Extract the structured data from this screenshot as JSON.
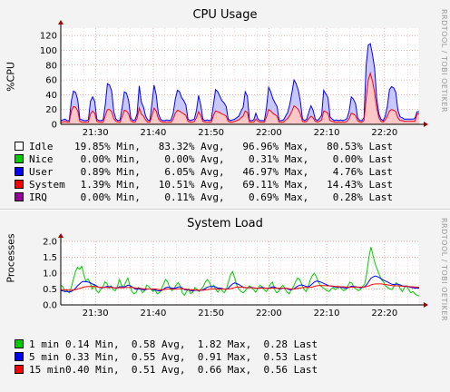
{
  "chart_data": [
    {
      "type": "area",
      "title": "CPU Usage",
      "ylabel": "%CPU",
      "side_label": "RRDTOOL / TOBI OETIKER",
      "ylim": [
        0,
        130
      ],
      "yticks": [
        "0",
        "20",
        "40",
        "60",
        "80",
        "100",
        "120"
      ],
      "xticks": [
        "21:30",
        "21:40",
        "21:50",
        "22:00",
        "22:10",
        "22:20"
      ],
      "xlim": [
        "21:24",
        "22:26"
      ],
      "grid": true,
      "series": [
        {
          "name": "Idle",
          "color": "#ffffff",
          "stats": "19.85% Min,   83.32% Avg,   96.96% Max,   80.53% Last"
        },
        {
          "name": "Nice",
          "color": "#00cc00",
          "stats": " 0.00% Min,    0.00% Avg,    0.31% Max,    0.00% Last"
        },
        {
          "name": "User",
          "color": "#0000ff",
          "stats": " 0.89% Min,    6.05% Avg,   46.97% Max,    4.76% Last",
          "values": [
            2,
            3,
            3,
            2,
            2,
            14,
            21,
            20,
            15,
            3,
            3,
            2,
            2,
            3,
            17,
            19,
            16,
            3,
            2,
            2,
            3,
            15,
            35,
            33,
            28,
            9,
            3,
            2,
            3,
            13,
            25,
            24,
            18,
            4,
            2,
            3,
            6,
            30,
            16,
            12,
            5,
            3,
            2,
            16,
            31,
            22,
            7,
            3,
            2,
            2,
            3,
            2,
            3,
            8,
            19,
            27,
            26,
            20,
            18,
            14,
            3,
            2,
            3,
            3,
            10,
            22,
            14,
            3,
            2,
            3,
            2,
            3,
            15,
            29,
            27,
            22,
            18,
            16,
            13,
            3,
            2,
            3,
            3,
            4,
            5,
            9,
            12,
            26,
            22,
            2,
            2,
            3,
            8,
            3,
            2,
            2,
            2,
            12,
            30,
            26,
            20,
            16,
            13,
            2,
            2,
            3,
            5,
            8,
            15,
            25,
            35,
            32,
            26,
            17,
            3,
            2,
            3,
            9,
            14,
            10,
            3,
            2,
            4,
            6,
            28,
            24,
            21,
            5,
            3,
            2,
            3,
            2,
            3,
            2,
            3,
            4,
            10,
            22,
            20,
            16,
            4,
            2,
            2,
            4,
            45,
            47,
            40,
            36,
            33,
            12,
            5,
            3,
            2,
            5,
            13,
            29,
            31,
            30,
            26,
            10,
            5,
            4,
            3,
            3,
            3,
            3,
            3,
            4,
            3,
            3
          ]
        },
        {
          "name": "System",
          "color": "#ff0000",
          "stats": " 1.39% Min,   10.51% Avg,   69.11% Max,   14.43% Last",
          "values": [
            3,
            3,
            4,
            3,
            3,
            18,
            24,
            23,
            18,
            4,
            3,
            3,
            3,
            3,
            14,
            18,
            15,
            4,
            3,
            3,
            3,
            12,
            20,
            20,
            17,
            8,
            4,
            3,
            3,
            11,
            19,
            18,
            14,
            5,
            3,
            3,
            8,
            22,
            14,
            11,
            6,
            3,
            3,
            12,
            22,
            18,
            8,
            4,
            3,
            3,
            3,
            3,
            3,
            7,
            15,
            19,
            18,
            16,
            14,
            12,
            4,
            3,
            3,
            4,
            9,
            17,
            12,
            4,
            3,
            3,
            3,
            3,
            12,
            18,
            17,
            16,
            14,
            13,
            11,
            4,
            3,
            3,
            4,
            5,
            6,
            9,
            11,
            18,
            16,
            3,
            3,
            3,
            7,
            4,
            3,
            3,
            3,
            10,
            20,
            18,
            15,
            13,
            11,
            3,
            3,
            3,
            6,
            8,
            12,
            18,
            25,
            23,
            20,
            14,
            4,
            3,
            4,
            8,
            11,
            9,
            4,
            3,
            4,
            6,
            18,
            17,
            15,
            5,
            4,
            3,
            3,
            3,
            3,
            3,
            3,
            4,
            8,
            15,
            14,
            12,
            5,
            3,
            3,
            5,
            35,
            60,
            69,
            58,
            43,
            22,
            9,
            4,
            3,
            6,
            11,
            18,
            20,
            19,
            17,
            9,
            5,
            5,
            4,
            4,
            4,
            4,
            4,
            4,
            14,
            14
          ]
        },
        {
          "name": "IRQ",
          "color": "#990099",
          "stats": " 0.00% Min,    0.11% Avg,    0.69% Max,    0.28% Last"
        }
      ]
    },
    {
      "type": "line",
      "title": "System Load",
      "ylabel": "Processes",
      "side_label": "RRDTOOL / TOBI OETIKER",
      "ylim": [
        0,
        2.0
      ],
      "yticks": [
        "0.0",
        "0.5",
        "1.0",
        "1.5",
        "2.0"
      ],
      "xticks": [
        "21:30",
        "21:40",
        "21:50",
        "22:00",
        "22:10",
        "22:20"
      ],
      "xlim": [
        "21:24",
        "22:26"
      ],
      "grid": true,
      "series": [
        {
          "name": "1 min",
          "color": "#00cc00",
          "stats": "0.14 Min,  0.58 Avg,  1.82 Max,  0.28 Last",
          "values": [
            0.62,
            0.58,
            0.42,
            0.45,
            0.38,
            0.55,
            0.8,
            1.05,
            1.18,
            1.12,
            1.22,
            0.95,
            0.75,
            0.82,
            0.7,
            0.5,
            0.62,
            0.45,
            0.38,
            0.48,
            0.55,
            0.72,
            0.68,
            0.52,
            0.6,
            0.48,
            0.45,
            0.58,
            0.8,
            0.62,
            0.55,
            0.72,
            0.85,
            0.6,
            0.42,
            0.35,
            0.4,
            0.55,
            0.5,
            0.38,
            0.45,
            0.62,
            0.58,
            0.5,
            0.42,
            0.48,
            0.35,
            0.38,
            0.5,
            0.65,
            0.8,
            0.72,
            0.55,
            0.45,
            0.5,
            0.62,
            0.7,
            0.6,
            0.38,
            0.3,
            0.42,
            0.5,
            0.35,
            0.4,
            0.55,
            0.48,
            0.42,
            0.5,
            0.58,
            0.72,
            0.8,
            0.7,
            0.55,
            0.62,
            0.48,
            0.4,
            0.52,
            0.45,
            0.38,
            0.5,
            0.72,
            0.95,
            1.05,
            0.85,
            0.62,
            0.5,
            0.42,
            0.38,
            0.45,
            0.52,
            0.6,
            0.55,
            0.48,
            0.4,
            0.5,
            0.62,
            0.58,
            0.48,
            0.42,
            0.5,
            0.65,
            0.72,
            0.5,
            0.38,
            0.42,
            0.55,
            0.62,
            0.5,
            0.4,
            0.35,
            0.48,
            0.58,
            0.72,
            0.85,
            0.8,
            0.65,
            0.5,
            0.42,
            0.55,
            0.78,
            0.92,
            1.0,
            0.88,
            0.72,
            0.6,
            0.55,
            0.5,
            0.45,
            0.42,
            0.5,
            0.55,
            0.48,
            0.52,
            0.58,
            0.5,
            0.45,
            0.48,
            0.6,
            0.72,
            0.68,
            0.55,
            0.5,
            0.45,
            0.48,
            0.58,
            0.65,
            1.0,
            1.5,
            1.82,
            1.55,
            1.3,
            1.12,
            0.95,
            0.8,
            0.72,
            0.6,
            0.55,
            0.5,
            0.48,
            0.58,
            0.7,
            0.65,
            0.5,
            0.42,
            0.55,
            0.6,
            0.48,
            0.38,
            0.42,
            0.35,
            0.3,
            0.28
          ]
        },
        {
          "name": "5 min",
          "color": "#0000ff",
          "stats": "0.33 Min,  0.55 Avg,  0.91 Max,  0.53 Last",
          "values": [
            0.45,
            0.44,
            0.42,
            0.42,
            0.41,
            0.42,
            0.46,
            0.52,
            0.6,
            0.66,
            0.72,
            0.74,
            0.73,
            0.72,
            0.7,
            0.66,
            0.64,
            0.6,
            0.56,
            0.54,
            0.54,
            0.56,
            0.58,
            0.57,
            0.57,
            0.55,
            0.53,
            0.53,
            0.57,
            0.57,
            0.56,
            0.58,
            0.62,
            0.61,
            0.57,
            0.52,
            0.49,
            0.5,
            0.5,
            0.48,
            0.47,
            0.49,
            0.5,
            0.5,
            0.48,
            0.48,
            0.45,
            0.44,
            0.45,
            0.49,
            0.54,
            0.56,
            0.55,
            0.53,
            0.52,
            0.54,
            0.56,
            0.57,
            0.53,
            0.48,
            0.47,
            0.47,
            0.45,
            0.44,
            0.46,
            0.46,
            0.45,
            0.46,
            0.48,
            0.52,
            0.56,
            0.58,
            0.57,
            0.58,
            0.56,
            0.53,
            0.53,
            0.52,
            0.49,
            0.49,
            0.53,
            0.6,
            0.66,
            0.69,
            0.67,
            0.64,
            0.6,
            0.56,
            0.54,
            0.54,
            0.55,
            0.55,
            0.54,
            0.52,
            0.52,
            0.54,
            0.55,
            0.54,
            0.52,
            0.52,
            0.54,
            0.57,
            0.56,
            0.53,
            0.51,
            0.51,
            0.53,
            0.53,
            0.51,
            0.48,
            0.48,
            0.5,
            0.54,
            0.59,
            0.62,
            0.63,
            0.61,
            0.58,
            0.57,
            0.6,
            0.66,
            0.72,
            0.75,
            0.74,
            0.72,
            0.69,
            0.66,
            0.63,
            0.6,
            0.59,
            0.58,
            0.56,
            0.56,
            0.56,
            0.55,
            0.54,
            0.53,
            0.54,
            0.57,
            0.59,
            0.58,
            0.57,
            0.55,
            0.54,
            0.55,
            0.57,
            0.64,
            0.74,
            0.84,
            0.88,
            0.91,
            0.89,
            0.86,
            0.82,
            0.78,
            0.75,
            0.72,
            0.68,
            0.65,
            0.64,
            0.65,
            0.65,
            0.63,
            0.6,
            0.59,
            0.59,
            0.57,
            0.55,
            0.54,
            0.53,
            0.53,
            0.53
          ]
        },
        {
          "name": "15 min",
          "color": "#ff0000",
          "stats": "0.40 Min,  0.51 Avg,  0.66 Max,  0.56 Last",
          "values": [
            0.48,
            0.48,
            0.47,
            0.47,
            0.46,
            0.46,
            0.47,
            0.48,
            0.5,
            0.52,
            0.54,
            0.56,
            0.57,
            0.58,
            0.58,
            0.58,
            0.58,
            0.57,
            0.56,
            0.55,
            0.55,
            0.55,
            0.55,
            0.55,
            0.55,
            0.54,
            0.54,
            0.54,
            0.54,
            0.54,
            0.54,
            0.55,
            0.55,
            0.55,
            0.55,
            0.54,
            0.53,
            0.52,
            0.52,
            0.51,
            0.51,
            0.51,
            0.5,
            0.5,
            0.5,
            0.5,
            0.49,
            0.48,
            0.48,
            0.48,
            0.49,
            0.5,
            0.5,
            0.5,
            0.5,
            0.5,
            0.51,
            0.51,
            0.51,
            0.5,
            0.49,
            0.48,
            0.48,
            0.47,
            0.47,
            0.47,
            0.46,
            0.46,
            0.46,
            0.47,
            0.48,
            0.49,
            0.5,
            0.5,
            0.5,
            0.5,
            0.5,
            0.5,
            0.5,
            0.49,
            0.5,
            0.51,
            0.53,
            0.55,
            0.56,
            0.56,
            0.56,
            0.55,
            0.55,
            0.54,
            0.54,
            0.54,
            0.54,
            0.53,
            0.53,
            0.53,
            0.53,
            0.53,
            0.53,
            0.52,
            0.52,
            0.53,
            0.53,
            0.53,
            0.52,
            0.52,
            0.52,
            0.52,
            0.52,
            0.51,
            0.5,
            0.5,
            0.51,
            0.52,
            0.53,
            0.54,
            0.55,
            0.55,
            0.55,
            0.55,
            0.56,
            0.58,
            0.6,
            0.61,
            0.61,
            0.61,
            0.61,
            0.6,
            0.6,
            0.59,
            0.59,
            0.58,
            0.58,
            0.57,
            0.57,
            0.57,
            0.56,
            0.56,
            0.56,
            0.56,
            0.56,
            0.56,
            0.56,
            0.56,
            0.56,
            0.56,
            0.58,
            0.6,
            0.63,
            0.65,
            0.66,
            0.66,
            0.66,
            0.66,
            0.65,
            0.64,
            0.63,
            0.62,
            0.61,
            0.6,
            0.6,
            0.6,
            0.59,
            0.59,
            0.58,
            0.58,
            0.58,
            0.57,
            0.57,
            0.56,
            0.56,
            0.56
          ]
        }
      ]
    }
  ]
}
